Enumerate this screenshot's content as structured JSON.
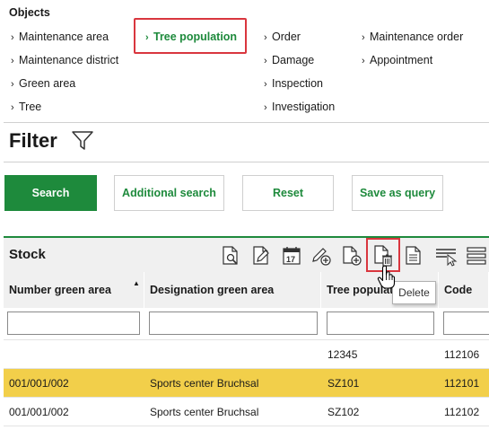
{
  "objects": {
    "title": "Objects",
    "columns": [
      [
        {
          "label": "Maintenance area",
          "selected": false
        },
        {
          "label": "Maintenance district",
          "selected": false
        },
        {
          "label": "Green area",
          "selected": false
        },
        {
          "label": "Tree",
          "selected": false
        }
      ],
      [
        {
          "label": "Tree population",
          "selected": true
        }
      ],
      [
        {
          "label": "Order",
          "selected": false
        },
        {
          "label": "Damage",
          "selected": false
        },
        {
          "label": "Inspection",
          "selected": false
        },
        {
          "label": "Investigation",
          "selected": false
        }
      ],
      [
        {
          "label": "Maintenance order",
          "selected": false
        },
        {
          "label": "Appointment",
          "selected": false
        }
      ]
    ]
  },
  "filter": {
    "title": "Filter",
    "buttons": {
      "search": "Search",
      "additional": "Additional search",
      "reset": "Reset",
      "save_query": "Save as query"
    }
  },
  "stock": {
    "title": "Stock",
    "toolbar_icons": [
      "view-document-icon",
      "edit-document-icon",
      "calendar-icon",
      "add-edit-icon",
      "add-document-icon",
      "delete-document-icon",
      "report-document-icon",
      "select-columns-icon",
      "menu-icon"
    ],
    "tooltip": "Delete",
    "columns": [
      "Number green area",
      "Designation green area",
      "Tree population",
      "Code"
    ],
    "rows": [
      {
        "number": "",
        "designation": "",
        "tree_population": "12345",
        "code": "112106",
        "highlighted": false
      },
      {
        "number": "001/001/002",
        "designation": "Sports center Bruchsal",
        "tree_population": "SZ101",
        "code": "112101",
        "highlighted": true
      },
      {
        "number": "001/001/002",
        "designation": "Sports center Bruchsal",
        "tree_population": "SZ102",
        "code": "112102",
        "highlighted": false
      }
    ]
  },
  "colors": {
    "accent": "#1e8a3c",
    "highlight": "#f2cf4a",
    "marker": "#d9363e"
  }
}
